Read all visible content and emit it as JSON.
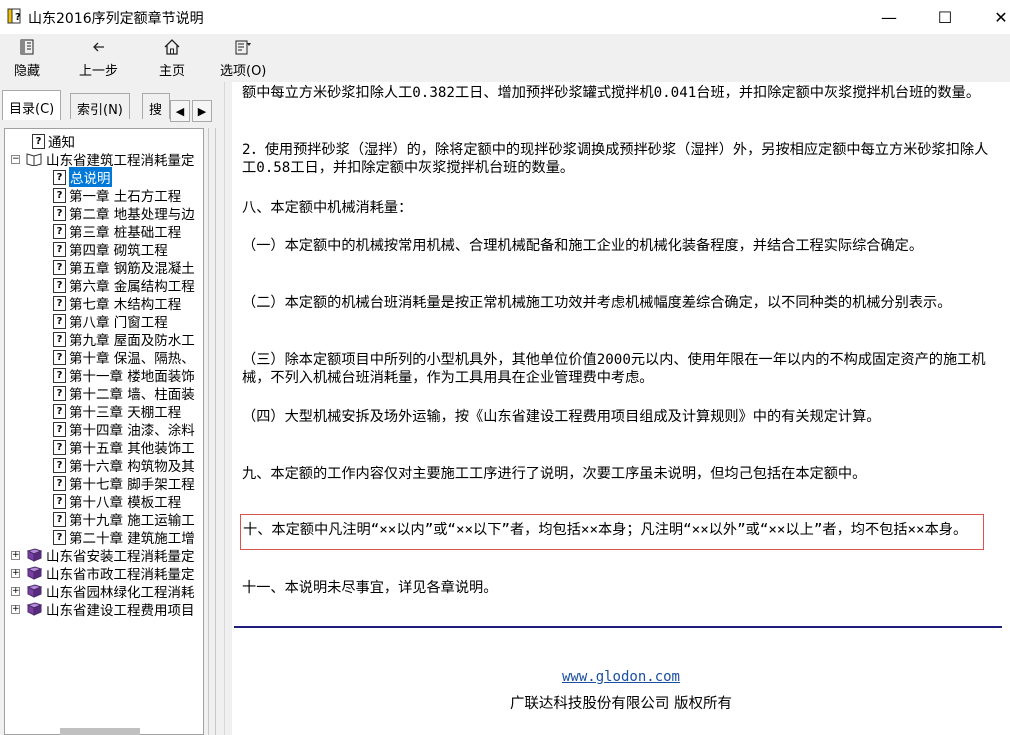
{
  "window": {
    "title": "山东2016序列定额章节说明",
    "minimize_glyph": "—",
    "maximize_glyph": "☐",
    "close_glyph": "✕"
  },
  "toolbar": {
    "hide_label": "隐藏",
    "back_label": "上一步",
    "home_label": "主页",
    "options_label": "选项(O)"
  },
  "tabs": {
    "contents_label": "目录(C)",
    "index_label": "索引(N)",
    "search_label": "搜",
    "left_arrow": "◀",
    "right_arrow": "▶"
  },
  "tree": {
    "expand_glyph": "+",
    "collapse_glyph": "−",
    "notice": "通知",
    "root_open": "山东省建筑工程消耗量定",
    "selected": "总说明",
    "chapters": [
      "第一章  土石方工程",
      "第二章  地基处理与边",
      "第三章  桩基础工程",
      "第四章  砌筑工程",
      "第五章  钢筋及混凝土",
      "第六章  金属结构工程",
      "第七章  木结构工程",
      "第八章  门窗工程",
      "第九章  屋面及防水工",
      "第十章  保温、隔热、",
      "第十一章  楼地面装饰",
      "第十二章  墙、柱面装",
      "第十三章  天棚工程",
      "第十四章  油漆、涂料",
      "第十五章  其他装饰工",
      "第十六章  构筑物及其",
      "第十七章  脚手架工程",
      "第十八章  模板工程",
      "第十九章  施工运输工",
      "第二十章  建筑施工增"
    ],
    "closed_roots": [
      "山东省安装工程消耗量定",
      "山东省市政工程消耗量定",
      "山东省园林绿化工程消耗",
      "山东省建设工程费用项目"
    ]
  },
  "content": {
    "paragraphs": [
      "额中每立方米砂浆扣除人工0.382工日、增加预拌砂浆罐式搅拌机0.041台班，并扣除定额中灰浆搅拌机台班的数量。",
      "2．使用预拌砂浆（湿拌）的，除将定额中的现拌砂浆调换成预拌砂浆（湿拌）外，另按相应定额中每立方米砂浆扣除人工0.58工日，并扣除定额中灰浆搅拌机台班的数量。",
      "八、本定额中机械消耗量：",
      "（一）本定额中的机械按常用机械、合理机械配备和施工企业的机械化装备程度，并结合工程实际综合确定。",
      "（二）本定额的机械台班消耗量是按正常机械施工功效并考虑机械幅度差综合确定，以不同种类的机械分别表示。",
      "（三）除本定额项目中所列的小型机具外，其他单位价值2000元以内、使用年限在一年以内的不构成固定资产的施工机械，不列入机械台班消耗量，作为工具用具在企业管理费中考虑。",
      "（四）大型机械安拆及场外运输，按《山东省建设工程费用项目组成及计算规则》中的有关规定计算。",
      "九、本定额的工作内容仅对主要施工工序进行了说明，次要工序虽未说明，但均己包括在本定额中。",
      "十、本定额中凡注明“××以内”或“××以下”者，均包括××本身；凡注明“××以外”或“××以上”者，均不包括××本身。",
      "十一、本说明未尽事宜，详见各章说明。"
    ],
    "footer_link": "www.glodon.com",
    "footer_copyright": "广联达科技股份有限公司 版权所有"
  },
  "colors": {
    "selection": "#0078d7",
    "highlight_border": "#d9534f",
    "rule": "#1f1f7a",
    "link": "#1a4fa0"
  }
}
